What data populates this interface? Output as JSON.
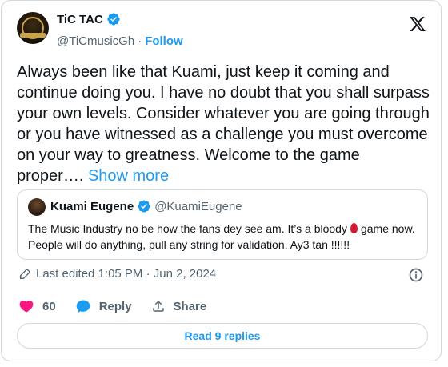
{
  "author": {
    "display_name": "TiC TAC",
    "handle": "@TiCmusicGh",
    "separator": "·",
    "follow_label": "Follow"
  },
  "tweet": {
    "text": "Always been like that Kuami, just keep it coming and continue doing you. I have no doubt that you shall surpass your own levels. Consider whatever you are going through or you have witnessed as a challenge you must overcome on your way to greatness. Welcome to the game proper….",
    "show_more_label": "Show more"
  },
  "quote": {
    "display_name": "Kuami Eugene",
    "handle": "@KuamiEugene",
    "text_before": "The Music Industry no be how the fans dey see am. It’s a bloody",
    "text_after": "game now. People will do anything, pull any string for validation. Ay3 tan !!!!!!",
    "emoji_icon": "drop-of-blood-icon"
  },
  "meta": {
    "edited_label": "Last edited 1:05 PM · Jun 2, 2024"
  },
  "actions": {
    "like_count": "60",
    "reply_label": "Reply",
    "share_label": "Share"
  },
  "read_replies_label": "Read 9 replies",
  "colors": {
    "accent": "#1d9bf0",
    "like": "#f91880",
    "text": "#0f1419",
    "muted": "#536471",
    "border": "#cfd9de"
  }
}
